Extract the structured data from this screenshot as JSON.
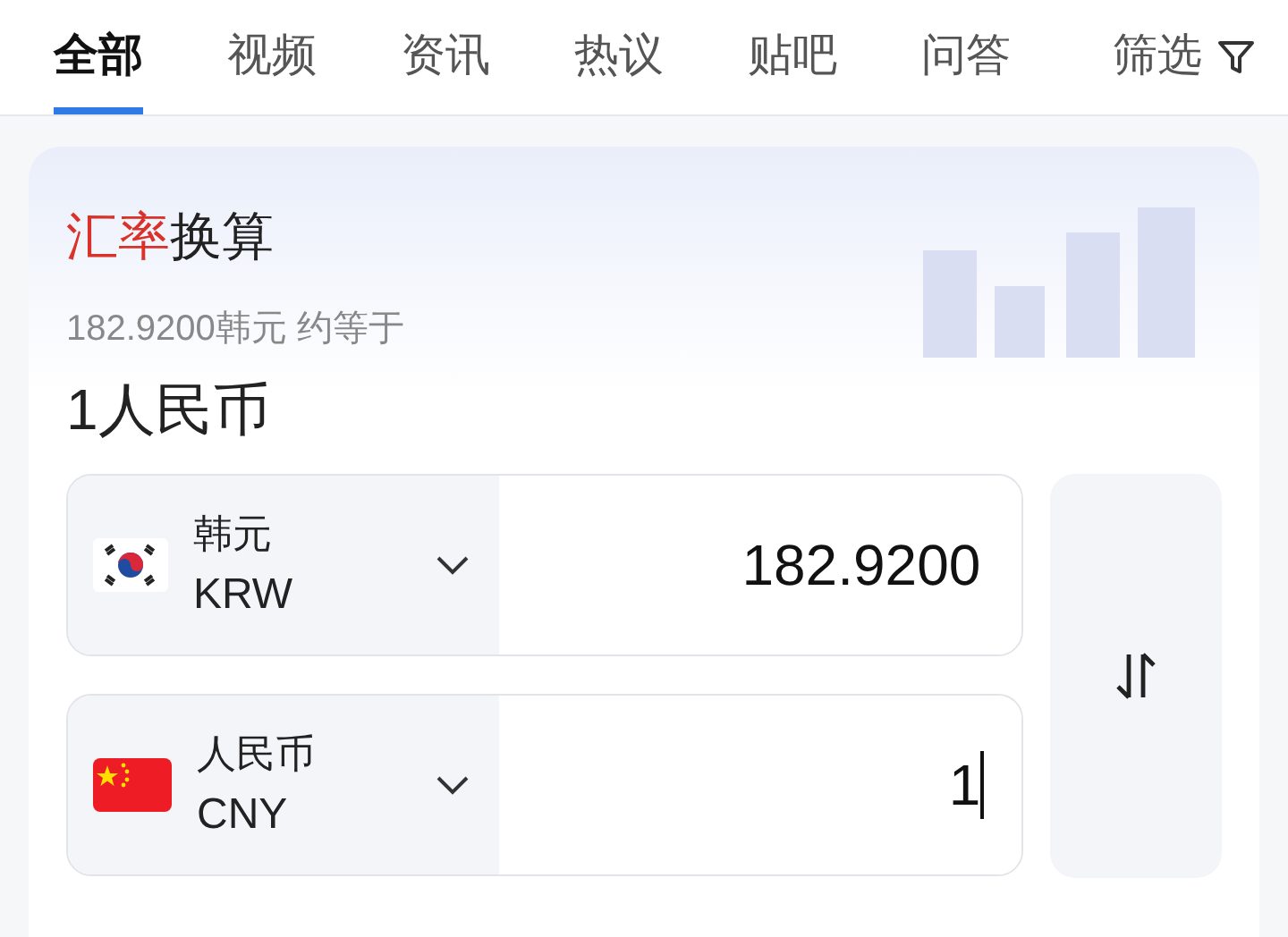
{
  "tabs": [
    {
      "label": "全部",
      "selected": true
    },
    {
      "label": "视频",
      "selected": false
    },
    {
      "label": "资讯",
      "selected": false
    },
    {
      "label": "热议",
      "selected": false
    },
    {
      "label": "贴吧",
      "selected": false
    },
    {
      "label": "问答",
      "selected": false
    }
  ],
  "filter": {
    "label": "筛选"
  },
  "converter": {
    "title": [
      {
        "text": "汇率",
        "highlighted": true
      },
      {
        "text": "换算",
        "highlighted": false
      }
    ],
    "rate_line": "182.9200韩元 约等于",
    "result": "1人民币",
    "rows": [
      {
        "name": "韩元",
        "code": "KRW",
        "kind": "kr",
        "amount": "182.9200",
        "focused": false
      },
      {
        "name": "人民币",
        "code": "CNY",
        "kind": "cn",
        "amount": "1",
        "focused": true
      }
    ]
  }
}
